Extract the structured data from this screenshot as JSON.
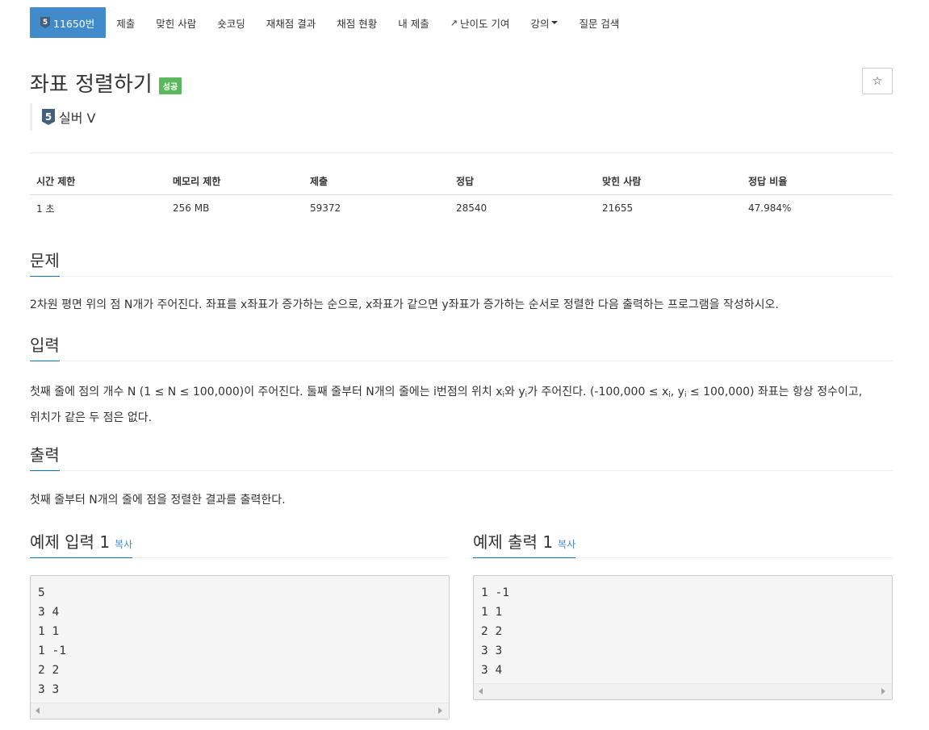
{
  "nav": {
    "problem_id": "11650번",
    "tier_badge": "5",
    "items": [
      "제출",
      "맞힌 사람",
      "숏코딩",
      "재채점 결과",
      "채점 현황",
      "내 제출",
      "난이도 기여",
      "강의",
      "질문 검색"
    ]
  },
  "title": "좌표 정렬하기",
  "status_badge": "성공",
  "star": "☆",
  "tier": {
    "badge": "5",
    "label": "실버 V"
  },
  "info": {
    "headers": [
      "시간 제한",
      "메모리 제한",
      "제출",
      "정답",
      "맞힌 사람",
      "정답 비율"
    ],
    "values": [
      "1 초",
      "256 MB",
      "59372",
      "28540",
      "21655",
      "47.984%"
    ]
  },
  "problem": {
    "heading": "문제",
    "text": "2차원 평면 위의 점 N개가 주어진다. 좌표를 x좌표가 증가하는 순으로, x좌표가 같으면 y좌표가 증가하는 순서로 정렬한 다음 출력하는 프로그램을 작성하시오."
  },
  "input": {
    "heading": "입력",
    "t1": "첫째 줄에 점의 개수 N (1 ≤ N ≤ 100,000)이 주어진다. 둘째 줄부터 N개의 줄에는 i번점의 위치 x",
    "sub1": "i",
    "t2": "와 y",
    "sub2": "i",
    "t3": "가 주어진다. (-100,000 ≤ x",
    "sub3": "i",
    "t4": ", y",
    "sub4": "i",
    "t5": " ≤ 100,000) 좌표는 항상 정수이고,",
    "line2": "위치가 같은 두 점은 없다."
  },
  "output": {
    "heading": "출력",
    "text": "첫째 줄부터 N개의 줄에 점을 정렬한 결과를 출력한다."
  },
  "sample_input": {
    "heading": "예제 입력 1",
    "copy": "복사",
    "code": "5\n3 4\n1 1\n1 -1\n2 2\n3 3"
  },
  "sample_output": {
    "heading": "예제 출력 1",
    "copy": "복사",
    "code": "1 -1\n1 1\n2 2\n3 3\n3 4"
  },
  "colors": {
    "nav_active": "#428bca",
    "success": "#5cb85c",
    "section_underline": "#0076c0",
    "tier": "#435f7a"
  }
}
